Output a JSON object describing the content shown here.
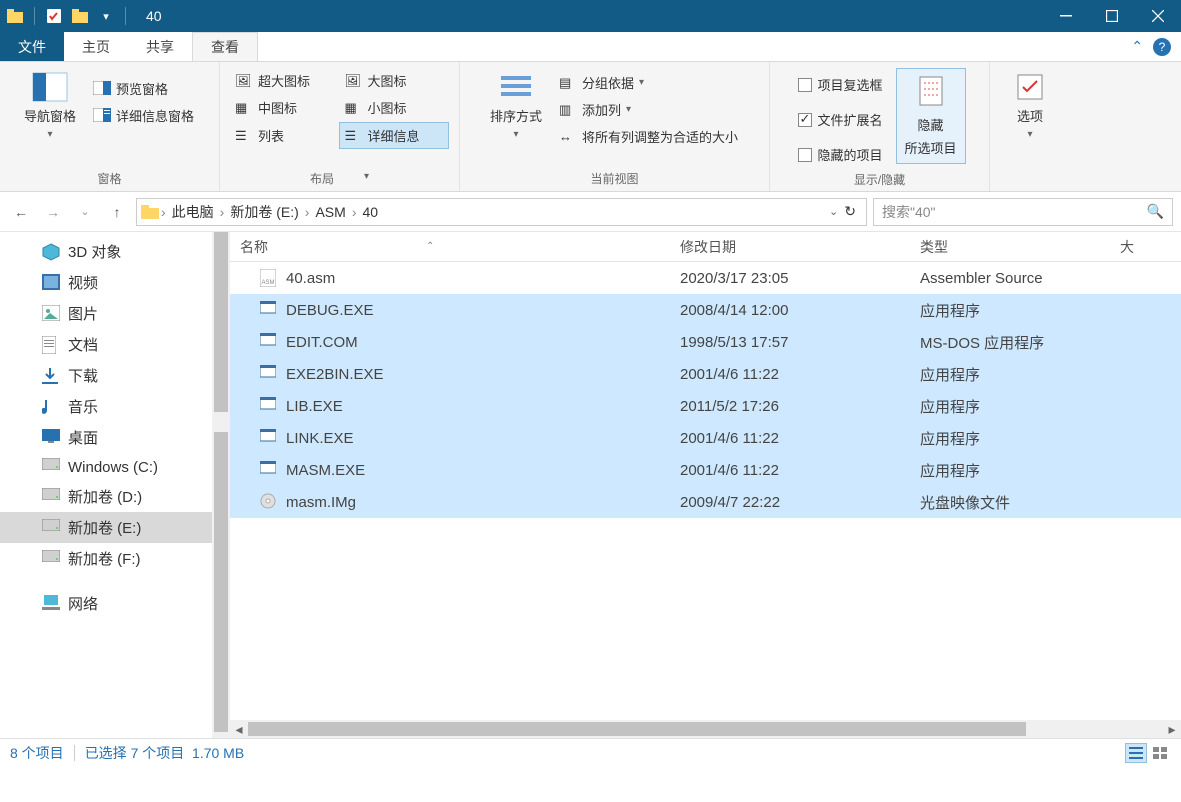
{
  "window": {
    "title": "40"
  },
  "tabs": {
    "file": "文件",
    "home": "主页",
    "share": "共享",
    "view": "查看"
  },
  "ribbon": {
    "panes_group": "窗格",
    "nav_pane": "导航窗格",
    "preview_pane": "预览窗格",
    "details_pane": "详细信息窗格",
    "layout_group": "布局",
    "xl_icons": "超大图标",
    "lg_icons": "大图标",
    "md_icons": "中图标",
    "sm_icons": "小图标",
    "list": "列表",
    "details": "详细信息",
    "sort_by": "排序方式",
    "group_by": "分组依据",
    "add_cols": "添加列",
    "fit_cols": "将所有列调整为合适的大小",
    "current_view": "当前视图",
    "item_checkboxes": "项目复选框",
    "file_ext": "文件扩展名",
    "hidden_items": "隐藏的项目",
    "hide_selected": "隐藏",
    "hide_selected2": "所选项目",
    "show_hide": "显示/隐藏",
    "options": "选项"
  },
  "breadcrumb": {
    "items": [
      "此电脑",
      "新加卷 (E:)",
      "ASM",
      "40"
    ]
  },
  "search": {
    "placeholder": "搜索\"40\""
  },
  "sidebar": {
    "items": [
      {
        "label": "3D 对象",
        "icon": "cube"
      },
      {
        "label": "视频",
        "icon": "video"
      },
      {
        "label": "图片",
        "icon": "picture"
      },
      {
        "label": "文档",
        "icon": "doc"
      },
      {
        "label": "下载",
        "icon": "download"
      },
      {
        "label": "音乐",
        "icon": "music"
      },
      {
        "label": "桌面",
        "icon": "desktop"
      },
      {
        "label": "Windows (C:)",
        "icon": "drive"
      },
      {
        "label": "新加卷 (D:)",
        "icon": "drive"
      },
      {
        "label": "新加卷 (E:)",
        "icon": "drive",
        "selected": true
      },
      {
        "label": "新加卷 (F:)",
        "icon": "drive"
      },
      {
        "label": "网络",
        "icon": "network"
      }
    ]
  },
  "columns": {
    "name": "名称",
    "date": "修改日期",
    "type": "类型",
    "size": "大"
  },
  "files": [
    {
      "name": "40.asm",
      "date": "2020/3/17 23:05",
      "type": "Assembler Source",
      "selected": false,
      "icon": "asm"
    },
    {
      "name": "DEBUG.EXE",
      "date": "2008/4/14 12:00",
      "type": "应用程序",
      "selected": true,
      "icon": "exe"
    },
    {
      "name": "EDIT.COM",
      "date": "1998/5/13 17:57",
      "type": "MS-DOS 应用程序",
      "selected": true,
      "icon": "exe"
    },
    {
      "name": "EXE2BIN.EXE",
      "date": "2001/4/6 11:22",
      "type": "应用程序",
      "selected": true,
      "icon": "exe"
    },
    {
      "name": "LIB.EXE",
      "date": "2011/5/2 17:26",
      "type": "应用程序",
      "selected": true,
      "icon": "exe"
    },
    {
      "name": "LINK.EXE",
      "date": "2001/4/6 11:22",
      "type": "应用程序",
      "selected": true,
      "icon": "exe"
    },
    {
      "name": "MASM.EXE",
      "date": "2001/4/6 11:22",
      "type": "应用程序",
      "selected": true,
      "icon": "exe"
    },
    {
      "name": "masm.IMg",
      "date": "2009/4/7 22:22",
      "type": "光盘映像文件",
      "selected": true,
      "icon": "iso"
    }
  ],
  "status": {
    "count": "8 个项目",
    "selected": "已选择 7 个项目",
    "size": "1.70 MB"
  }
}
